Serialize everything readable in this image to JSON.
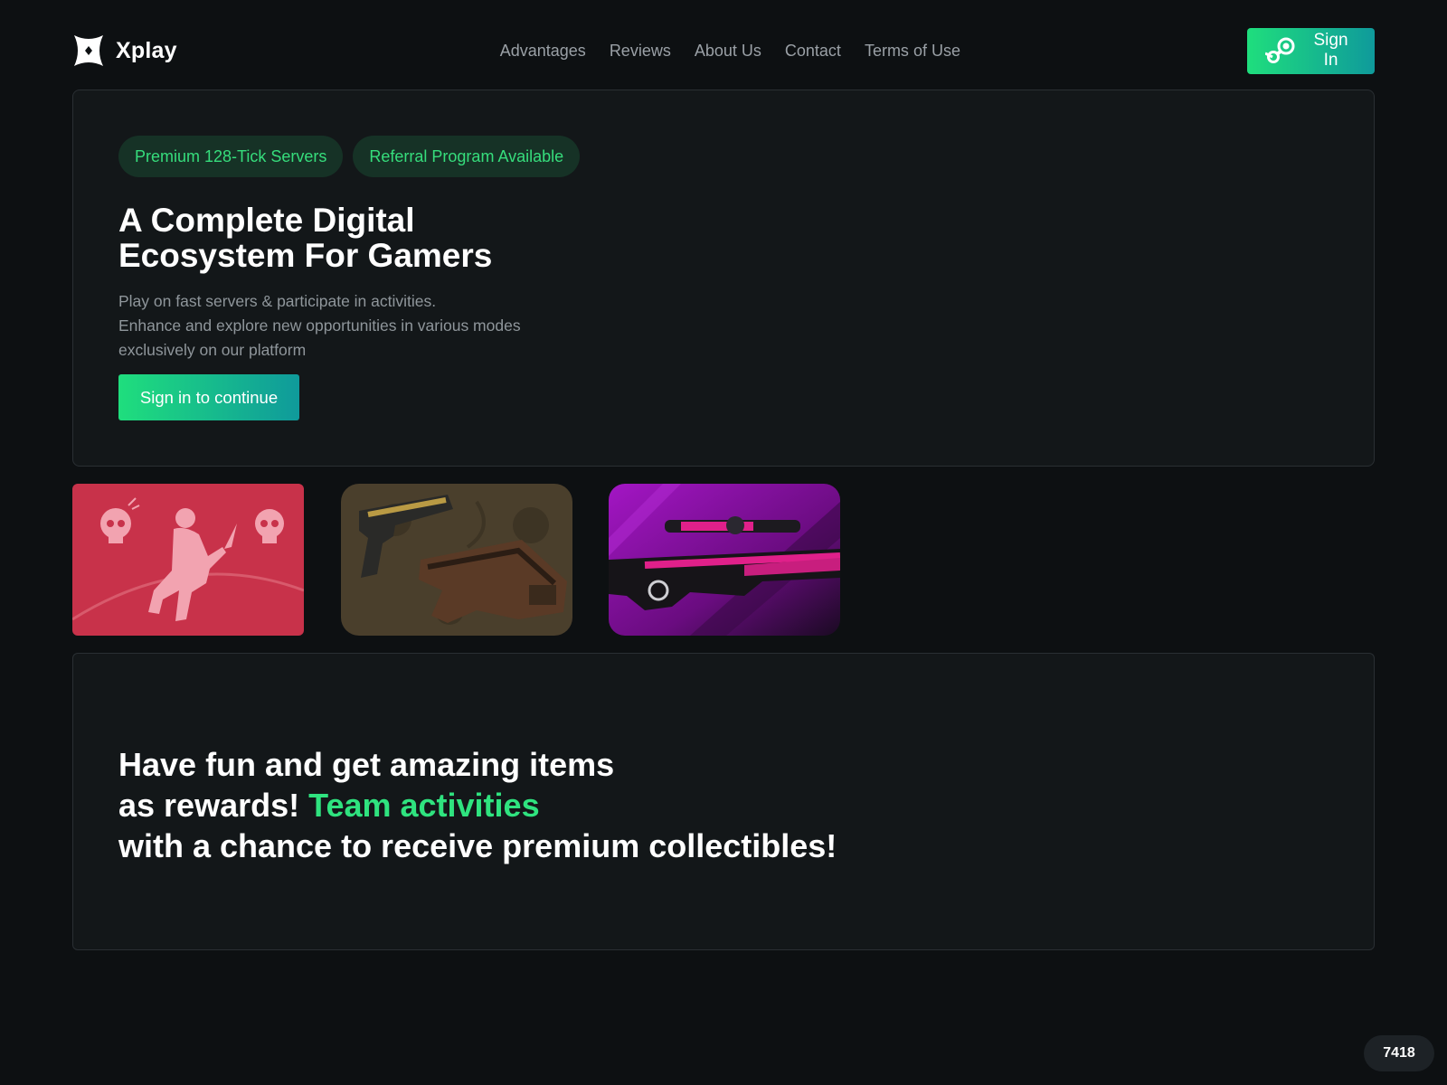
{
  "header": {
    "logo_text": "Xplay",
    "nav": [
      "Advantages",
      "Reviews",
      "About Us",
      "Contact",
      "Terms of Use"
    ],
    "signin_label": "Sign In",
    "signin_icon": "steam-icon"
  },
  "hero": {
    "pills": [
      "Premium 128-Tick Servers",
      "Referral Program Available"
    ],
    "title_line1": "A Complete Digital",
    "title_line2": "Ecosystem For Gamers",
    "desc_line1": "Play on fast servers & participate in activities.",
    "desc_line2": "Enhance and explore new opportunities in various modes",
    "desc_line3": "exclusively on our platform",
    "cta_label": "Sign in to continue"
  },
  "tiles": [
    {
      "icon": "knife-kill-icon",
      "bg_color": "#c8324a"
    },
    {
      "icon": "weapon-skins-pistol-smg-image",
      "bg_color": "#4a3f2c"
    },
    {
      "icon": "sniper-rifle-skin-image",
      "bg_color": "#8a14a8"
    }
  ],
  "promo": {
    "line1": "Have fun and get amazing items",
    "line2_prefix": "as rewards! ",
    "line2_accent": "Team activities",
    "line3": "with a chance to receive premium collectibles!"
  },
  "counter": "7418",
  "colors": {
    "background": "#0d1012",
    "card": "#131719",
    "accent_green": "#2fe37f",
    "gradient_start": "#1fde7d",
    "gradient_end": "#0f9a9b",
    "pill_bg": "#163226"
  }
}
